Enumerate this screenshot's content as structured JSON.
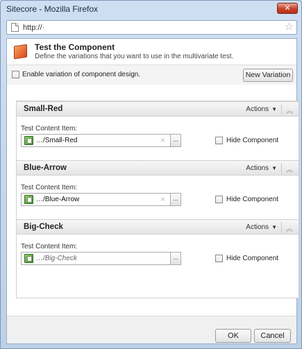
{
  "window": {
    "title": "Sitecore - Mozilla Firefox",
    "close_symbol": "✕"
  },
  "urlbar": {
    "url": "http://·"
  },
  "header": {
    "title": "Test the Component",
    "subtitle": "Define the variations that you want to use in the multivariate test."
  },
  "toolbar": {
    "enable_label": "Enable variation of component design.",
    "new_variation_label": "New Variation"
  },
  "variations": [
    {
      "name": "Small-Red",
      "actions_label": "Actions",
      "field_label": "Test Content Item:",
      "item_value": "…/Small-Red",
      "item_is_placeholder": false,
      "hide_label": "Hide Component"
    },
    {
      "name": "Blue-Arrow",
      "actions_label": "Actions",
      "field_label": "Test Content Item:",
      "item_value": "…/Blue-Arrow",
      "item_is_placeholder": false,
      "hide_label": "Hide Component"
    },
    {
      "name": "Big-Check",
      "actions_label": "Actions",
      "field_label": "Test Content Item:",
      "item_value": "…/Big-Check",
      "item_is_placeholder": true,
      "hide_label": "Hide Component"
    }
  ],
  "footer": {
    "ok_label": "OK",
    "cancel_label": "Cancel"
  }
}
